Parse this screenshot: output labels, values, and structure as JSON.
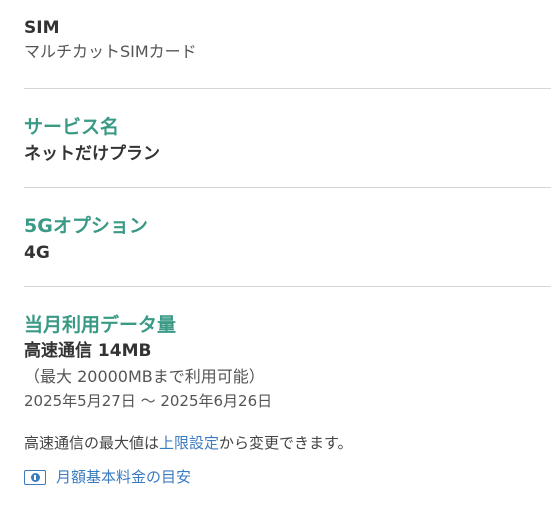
{
  "sim": {
    "title": "SIM",
    "value": "マルチカットSIMカード"
  },
  "service": {
    "title": "サービス名",
    "value": "ネットだけプラン"
  },
  "option_5g": {
    "title": "5Gオプション",
    "value": "4G"
  },
  "usage": {
    "title": "当月利用データ量",
    "value": "高速通信 14MB",
    "cap": "（最大 20000MBまで利用可能）",
    "period": "2025年5月27日 ～ 2025年6月26日"
  },
  "note": {
    "prefix": "高速通信の最大値は",
    "link": "上限設定",
    "suffix": "から変更できます。"
  },
  "guide": {
    "icon": "money-icon",
    "label": "月額基本料金の目安"
  },
  "colors": {
    "accent": "#3a9a86",
    "link": "#3b7bbf",
    "divider": "#d6d6d6"
  }
}
